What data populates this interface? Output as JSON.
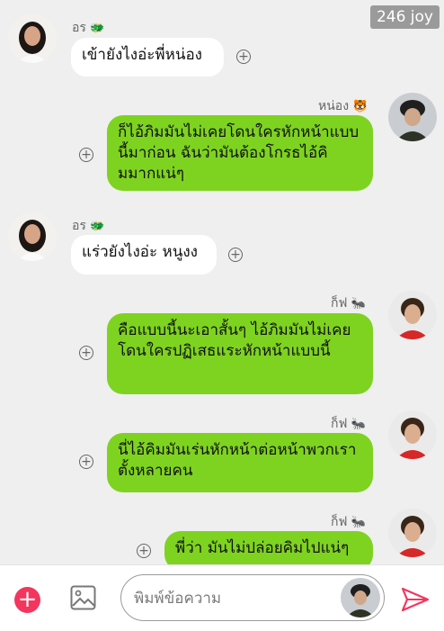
{
  "watermark": "246 joy",
  "messages": [
    {
      "sender": "อร",
      "sender_emoji": "🐲",
      "text": "เข้ายังไงอ่ะพี่หน่อง",
      "side": "left"
    },
    {
      "sender": "หน่อง",
      "sender_emoji": "🐯",
      "text": "ก็ไอ้ภิมมันไม่เคยโดนใครหักหน้าแบบนี้มาก่อน ฉันว่ามันต้องโกรธไอ้คิมมากแน่ๆ",
      "side": "right"
    },
    {
      "sender": "อร",
      "sender_emoji": "🐲",
      "text": "แร่วยังไงอ่ะ หนูงง",
      "side": "left"
    },
    {
      "sender": "ก็ฟ",
      "sender_emoji": "🐜",
      "text": "คือแบบนี้นะเอาสั้นๆ ไอ้ภิมมันไม่เคยโดนใครปฏิเสธแระหักหน้าแบบนี้",
      "side": "right"
    },
    {
      "sender": "ก็ฟ",
      "sender_emoji": "🐜",
      "text": "นี่ไอ้คิมมันเร่นหักหน้าต่อหน้าพวกเราตั้งหลายคน",
      "side": "right"
    },
    {
      "sender": "ก็ฟ",
      "sender_emoji": "🐜",
      "text": "พี่ว่า มันไม่ปล่อยคิมไปแน่ๆ",
      "side": "right"
    }
  ],
  "input": {
    "placeholder": "พิมพ์ข้อความ",
    "value": ""
  },
  "colors": {
    "bubble_self": "#7ed321",
    "bubble_other": "#ffffff",
    "background": "#efefef",
    "accent": "#f2365e"
  },
  "icons": {
    "add": "plus-circle-icon",
    "gallery": "image-icon",
    "send": "send-icon",
    "react": "add-reaction-icon"
  }
}
